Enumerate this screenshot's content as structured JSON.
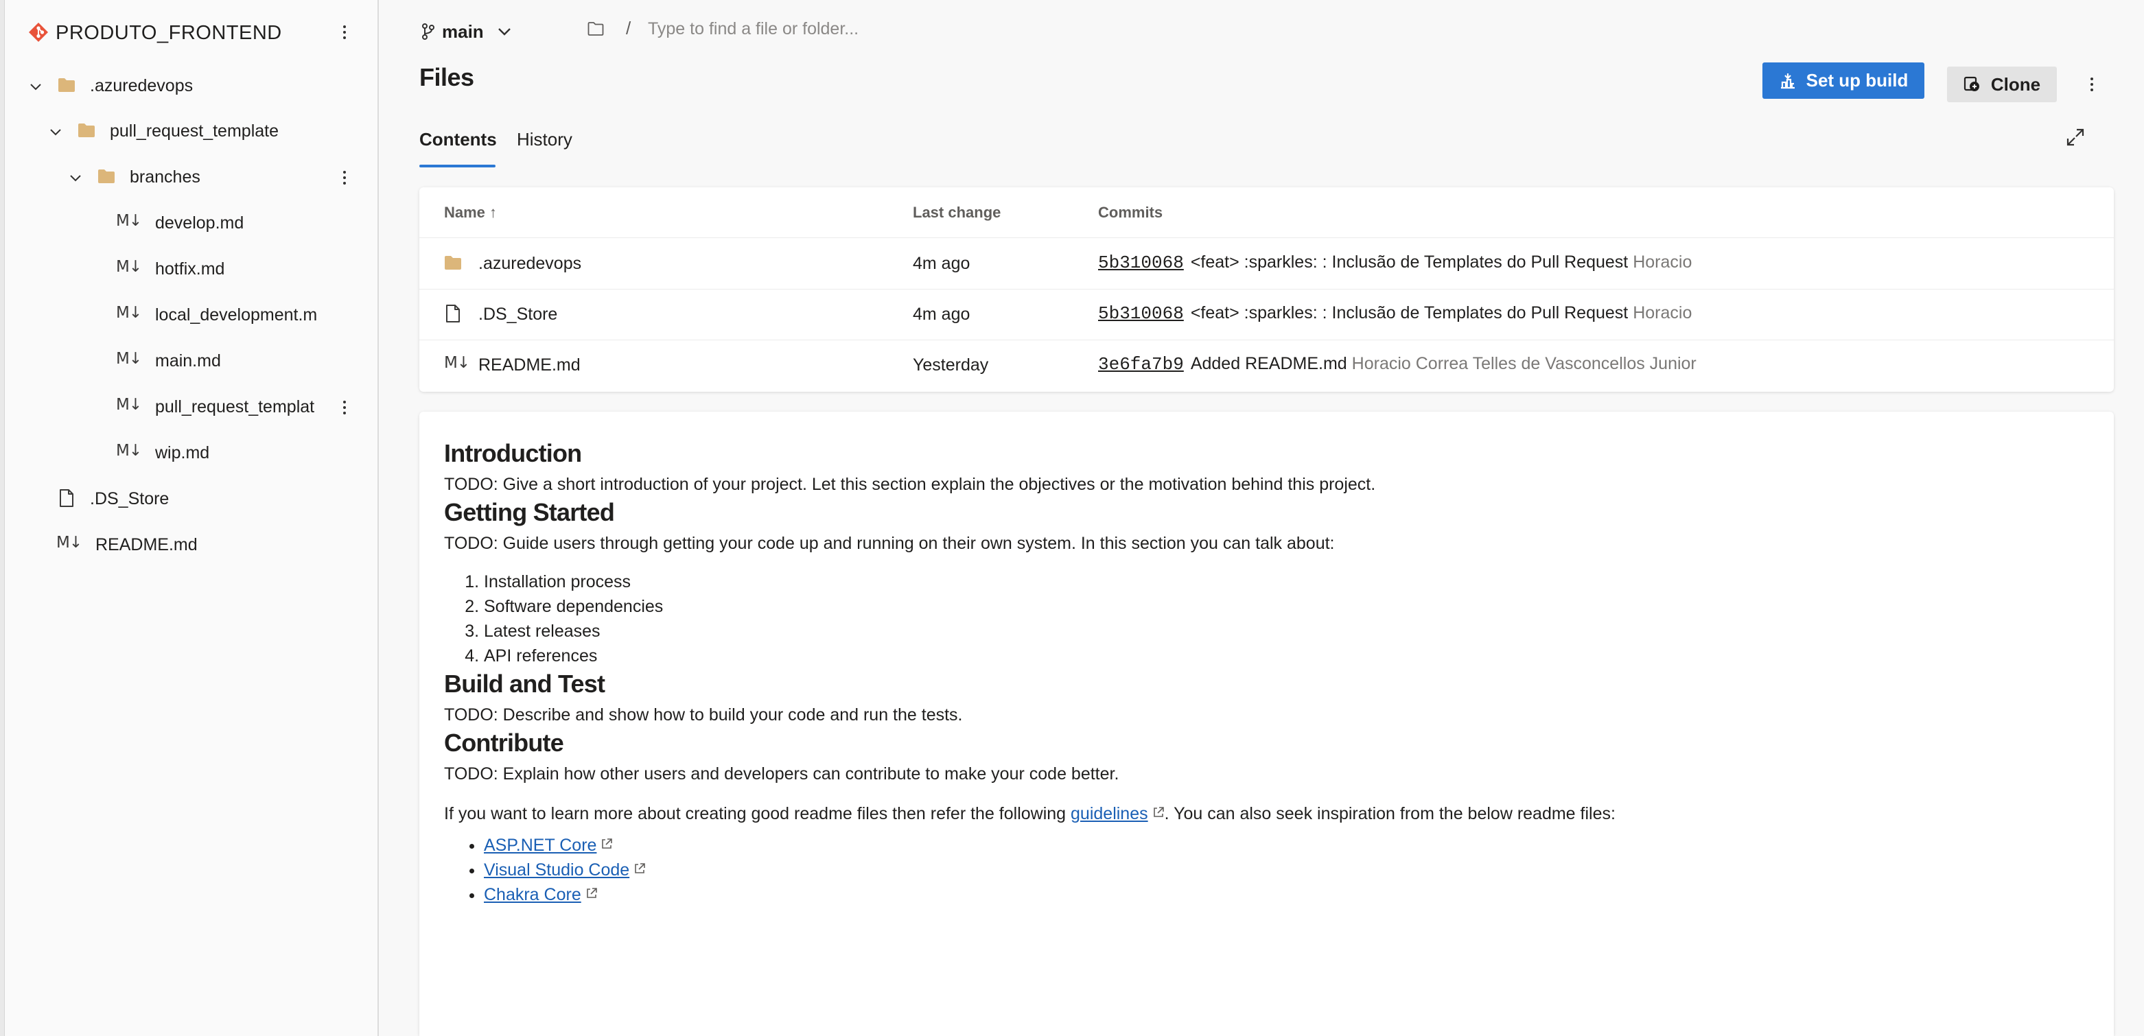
{
  "repo": {
    "name": "PRODUTO_FRONTEND"
  },
  "tree": [
    {
      "label": ".azuredevops",
      "kind": "folder",
      "expanded": true,
      "depth": 0
    },
    {
      "label": "pull_request_template",
      "kind": "folder",
      "expanded": true,
      "depth": 1
    },
    {
      "label": "branches",
      "kind": "folder",
      "expanded": true,
      "depth": 2
    },
    {
      "label": "develop.md",
      "kind": "markdown",
      "depth": 3
    },
    {
      "label": "hotfix.md",
      "kind": "markdown",
      "depth": 3
    },
    {
      "label": "local_development.m",
      "kind": "markdown",
      "depth": 3
    },
    {
      "label": "main.md",
      "kind": "markdown",
      "depth": 3
    },
    {
      "label": "pull_request_templat",
      "kind": "markdown",
      "depth": 3
    },
    {
      "label": "wip.md",
      "kind": "markdown",
      "depth": 3
    },
    {
      "label": ".DS_Store",
      "kind": "file",
      "depth": 0
    },
    {
      "label": "README.md",
      "kind": "markdown",
      "depth": 0
    }
  ],
  "topbar": {
    "branch": "main",
    "path_separator": "/",
    "path_placeholder": "Type to find a file or folder..."
  },
  "page": {
    "title": "Files",
    "setup_build_label": "Set up build",
    "clone_label": "Clone"
  },
  "tabs": [
    {
      "label": "Contents",
      "active": true
    },
    {
      "label": "History",
      "active": false
    }
  ],
  "files_table": {
    "columns": {
      "name": "Name ↑",
      "last_change": "Last change",
      "commits": "Commits"
    },
    "rows": [
      {
        "icon": "folder-icon",
        "name": ".azuredevops",
        "last_change": "4m ago",
        "hash": "5b310068",
        "message": "<feat> :sparkles: : Inclusão de Templates do Pull Request",
        "author": "Horacio"
      },
      {
        "icon": "file-icon",
        "name": ".DS_Store",
        "last_change": "4m ago",
        "hash": "5b310068",
        "message": "<feat> :sparkles: : Inclusão de Templates do Pull Request",
        "author": "Horacio"
      },
      {
        "icon": "markdown-icon",
        "name": "README.md",
        "last_change": "Yesterday",
        "hash": "3e6fa7b9",
        "message": "Added README.md",
        "author": "Horacio Correa Telles de Vasconcellos Junior"
      }
    ]
  },
  "readme": {
    "intro_title": "Introduction",
    "intro_text": "TODO: Give a short introduction of your project. Let this section explain the objectives or the motivation behind this project.",
    "start_title": "Getting Started",
    "start_text": "TODO: Guide users through getting your code up and running on their own system. In this section you can talk about:",
    "start_items": [
      "Installation process",
      "Software dependencies",
      "Latest releases",
      "API references"
    ],
    "build_title": "Build and Test",
    "build_text": "TODO: Describe and show how to build your code and run the tests.",
    "contrib_title": "Contribute",
    "contrib_text": "TODO: Explain how other users and developers can contribute to make your code better.",
    "more_prefix": "If you want to learn more about creating good readme files then refer the following ",
    "more_link": "guidelines",
    "more_suffix": ". You can also seek inspiration from the below readme files:",
    "links": [
      "ASP.NET Core",
      "Visual Studio Code",
      "Chakra Core"
    ]
  },
  "colors": {
    "accent": "#2b78d4",
    "folder": "#dcb67a",
    "logo": "#e8533a",
    "link": "#1a5fb4"
  }
}
